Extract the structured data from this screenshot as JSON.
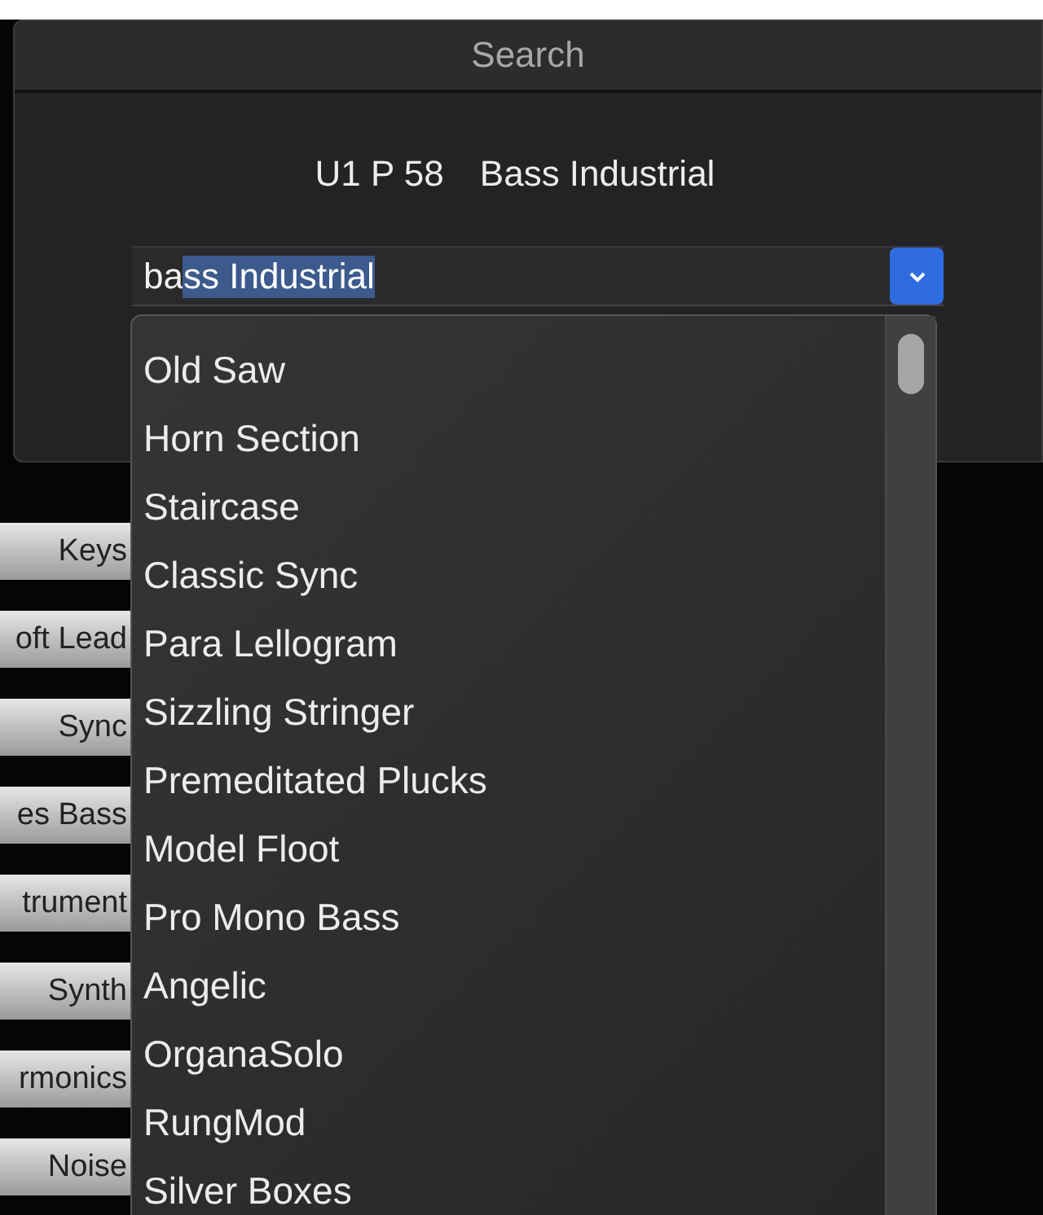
{
  "dialog": {
    "title": "Search",
    "patch_number": "U1 P 58",
    "patch_name": "Bass Industrial"
  },
  "search_field": {
    "typed_text": "ba",
    "autocompleted_text": "ss Industrial",
    "dropdown_open": true
  },
  "suggestions": [
    {
      "label": "Old Saw"
    },
    {
      "label": "Horn Section"
    },
    {
      "label": "Staircase"
    },
    {
      "label": "Classic Sync"
    },
    {
      "label": "Para Lellogram"
    },
    {
      "label": "Sizzling Stringer"
    },
    {
      "label": "Premeditated Plucks"
    },
    {
      "label": "Model Floot"
    },
    {
      "label": "Pro Mono Bass"
    },
    {
      "label": "Angelic"
    },
    {
      "label": "OrganaSolo"
    },
    {
      "label": "RungMod"
    },
    {
      "label": "Silver Boxes"
    }
  ],
  "category_buttons": [
    "Keys",
    "oft Lead",
    "Sync",
    "es Bass",
    "trument",
    "Synth",
    "rmonics",
    "Noise"
  ]
}
